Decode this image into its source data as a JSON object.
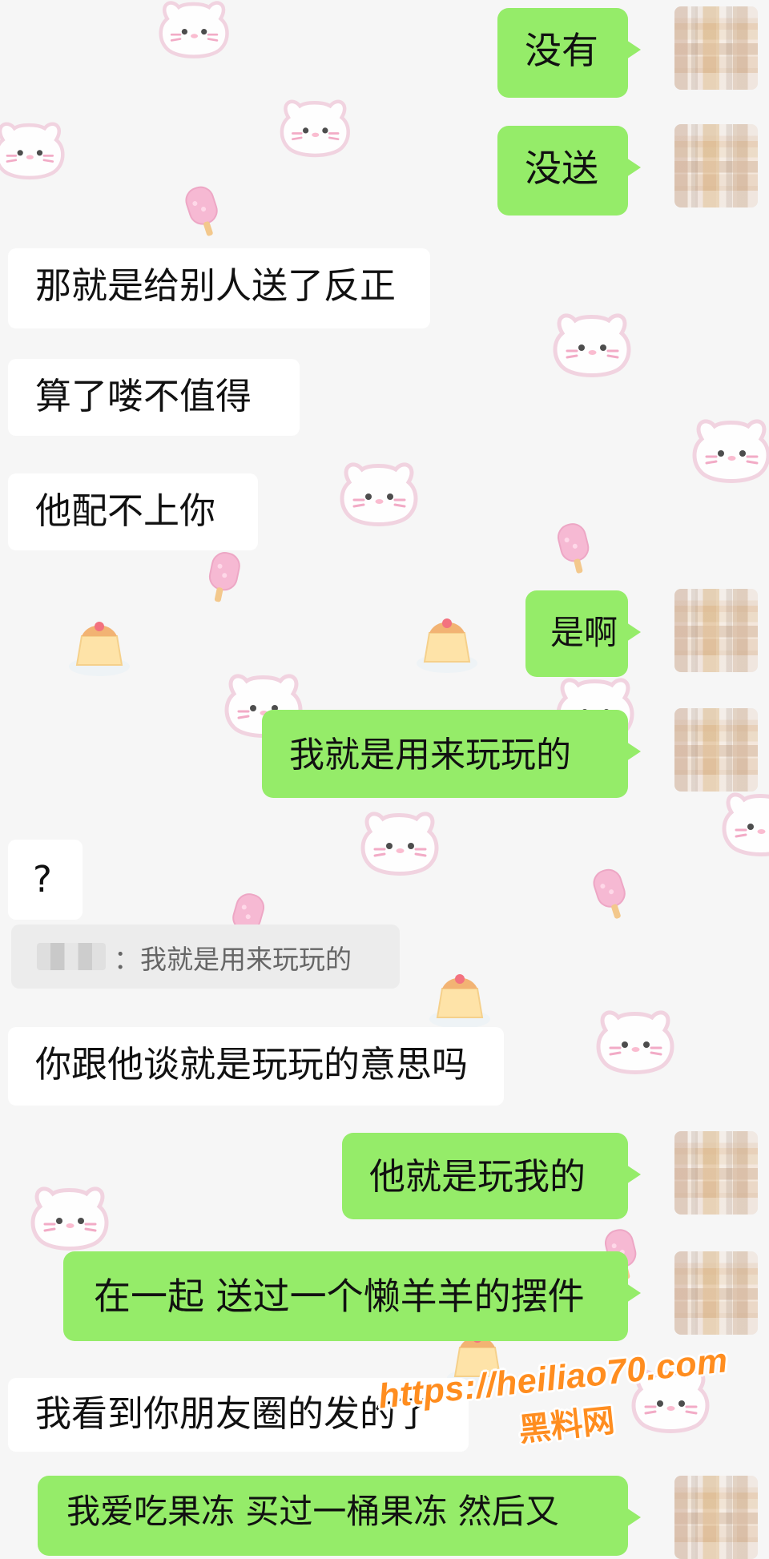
{
  "messages": [
    {
      "text": "没有",
      "side": "right"
    },
    {
      "text": "没送",
      "side": "right"
    },
    {
      "text": "那就是给别人送了反正",
      "side": "left"
    },
    {
      "text": "算了喽不值得",
      "side": "left"
    },
    {
      "text": "他配不上你",
      "side": "left"
    },
    {
      "text": "是啊",
      "side": "right"
    },
    {
      "text": "我就是用来玩玩的",
      "side": "right"
    },
    {
      "text": "?",
      "side": "left"
    },
    {
      "text": "你跟他谈就是玩玩的意思吗",
      "side": "left"
    },
    {
      "text": "他就是玩我的",
      "side": "right"
    },
    {
      "text": "在一起 送过一个懒羊羊的摆件",
      "side": "right"
    },
    {
      "text": "我看到你朋友圈的发的了",
      "side": "left"
    },
    {
      "text": "我爱吃果冻 买过一桶果冻 然后又",
      "side": "right"
    }
  ],
  "quote": {
    "text": "：我就是用来玩玩的"
  },
  "watermark": {
    "url": "https://heiliao70.com",
    "cn": "黑料网"
  },
  "colors": {
    "background": "#f6f6f6",
    "bubble_right": "#95ec69",
    "bubble_left": "#ffffff",
    "watermark": "#ff8d1f"
  },
  "icons": [
    "cat-face-icon",
    "popsicle-icon",
    "pudding-icon",
    "blurred-avatar-icon"
  ]
}
